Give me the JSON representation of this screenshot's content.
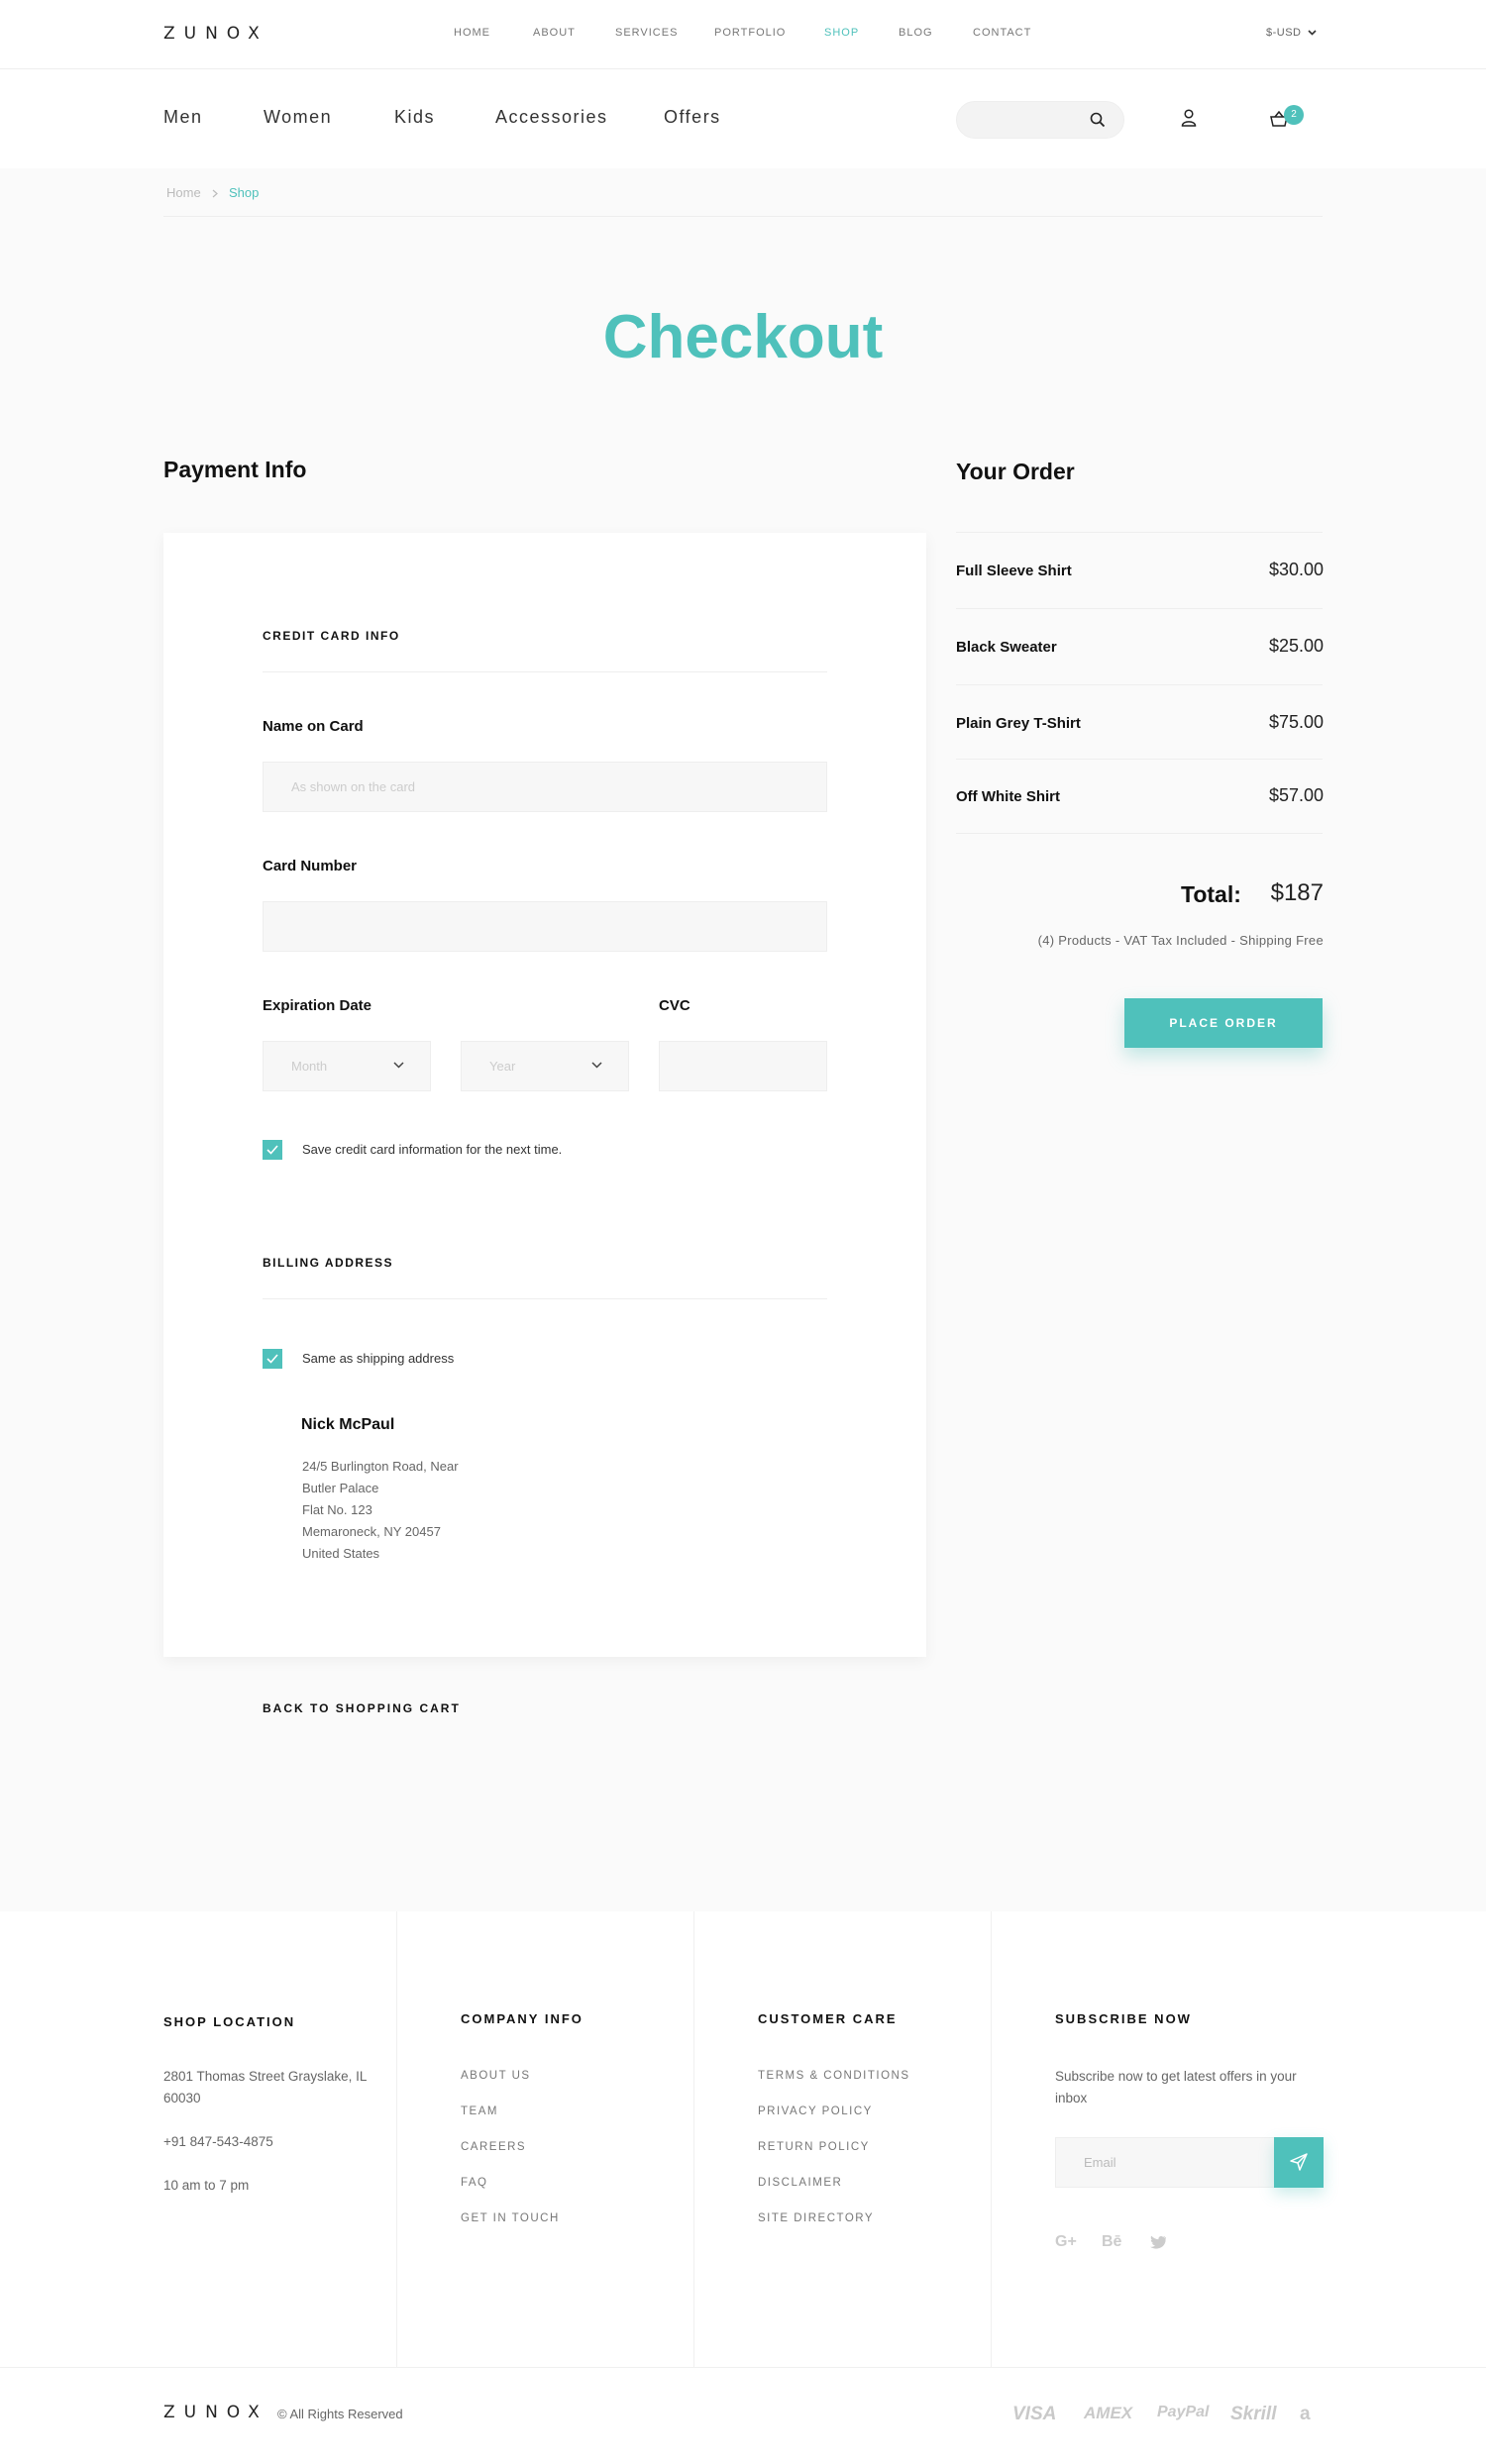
{
  "brand": "ZUNOX",
  "top_nav": [
    "HOME",
    "ABOUT",
    "SERVICES",
    "PORTFOLIO",
    "SHOP",
    "BLOG",
    "CONTACT"
  ],
  "top_nav_active": "SHOP",
  "currency": "$-USD",
  "categories": [
    "Men",
    "Women",
    "Kids",
    "Accessories",
    "Offers"
  ],
  "cart_count": "2",
  "breadcrumb": [
    "Home",
    "Shop"
  ],
  "page_title": "Checkout",
  "payment": {
    "heading": "Payment Info",
    "credit_card_heading": "CREDIT CARD INFO",
    "name_label": "Name on Card",
    "name_placeholder": "As shown on the card",
    "card_number_label": "Card Number",
    "expiration_label": "Expiration Date",
    "month_placeholder": "Month",
    "year_placeholder": "Year",
    "cvc_label": "CVC",
    "save_card_text": "Save credit card information for the next time.",
    "billing_heading": "BILLING ADDRESS",
    "same_as_shipping_text": "Same as shipping address",
    "address": {
      "name": "Nick McPaul",
      "lines": [
        "24/5 Burlington Road, Near",
        "Butler Palace",
        "Flat No. 123",
        "Memaroneck, NY 20457",
        "United States"
      ]
    },
    "back_link": "BACK TO SHOPPING CART"
  },
  "order": {
    "heading": "Your Order",
    "items": [
      {
        "name": "Full Sleeve Shirt",
        "price": "$30.00"
      },
      {
        "name": "Black Sweater",
        "price": "$25.00"
      },
      {
        "name": "Plain Grey T-Shirt",
        "price": "$75.00"
      },
      {
        "name": "Off White Shirt",
        "price": "$57.00"
      }
    ],
    "total_label": "Total:",
    "total_value": "$187",
    "total_note": "(4) Products - VAT Tax Included - Shipping Free",
    "place_order": "PLACE ORDER"
  },
  "footer": {
    "shop_location": {
      "heading": "SHOP LOCATION",
      "address": "2801 Thomas Street Grayslake, IL 60030",
      "phone": "+91 847-543-4875",
      "hours": "10 am to 7 pm"
    },
    "company_info": {
      "heading": "COMPANY INFO",
      "links": [
        "ABOUT US",
        "TEAM",
        "CAREERS",
        "FAQ",
        "GET IN TOUCH"
      ]
    },
    "customer_care": {
      "heading": "CUSTOMER CARE",
      "links": [
        "TERMS & CONDITIONS",
        "PRIVACY POLICY",
        "RETURN POLICY",
        "DISCLAIMER",
        "SITE DIRECTORY"
      ]
    },
    "subscribe": {
      "heading": "SUBSCRIBE NOW",
      "text": "Subscribe now to get latest offers in your inbox",
      "email_placeholder": "Email"
    },
    "social": [
      "G+",
      "Bē",
      "twitter-icon"
    ],
    "copyright": "© All Rights Reserved",
    "payment_logos": [
      "VISA",
      "AMEX",
      "PayPal",
      "Skrill",
      "a"
    ]
  },
  "colors": {
    "accent": "#4fc1bb",
    "background": "#fafafa"
  }
}
